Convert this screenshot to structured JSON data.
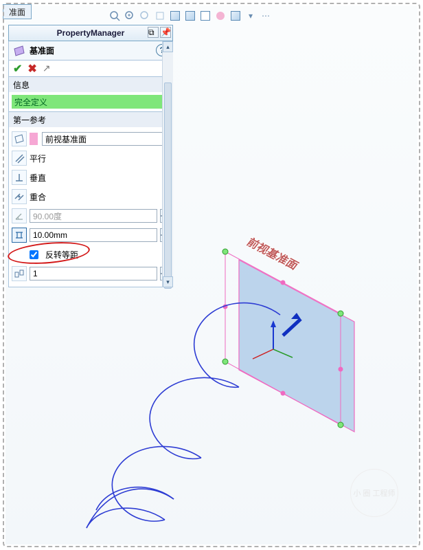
{
  "window": {
    "tab_label": "准面"
  },
  "property_manager": {
    "title": "PropertyManager",
    "feature_label": "基准面",
    "help_label": "?"
  },
  "info_section": {
    "header": "信息",
    "status": "完全定义"
  },
  "first_ref": {
    "header": "第一参考",
    "selection": "前视基准面",
    "parallel": "平行",
    "perpendicular": "垂直",
    "coincident": "重合",
    "angle_value": "90.00度",
    "distance_value": "10.00mm",
    "flip_label": "反转等距",
    "flip_checked": true,
    "instances": "1"
  },
  "scene": {
    "plane_label": "前视基准面",
    "watermark": "小 圈\n工程师"
  },
  "colors": {
    "accent": "#3a75b5",
    "plane_fill": "#8cb6e0",
    "plane_edge": "#ef6ac1",
    "helix": "#2d3cd3"
  }
}
